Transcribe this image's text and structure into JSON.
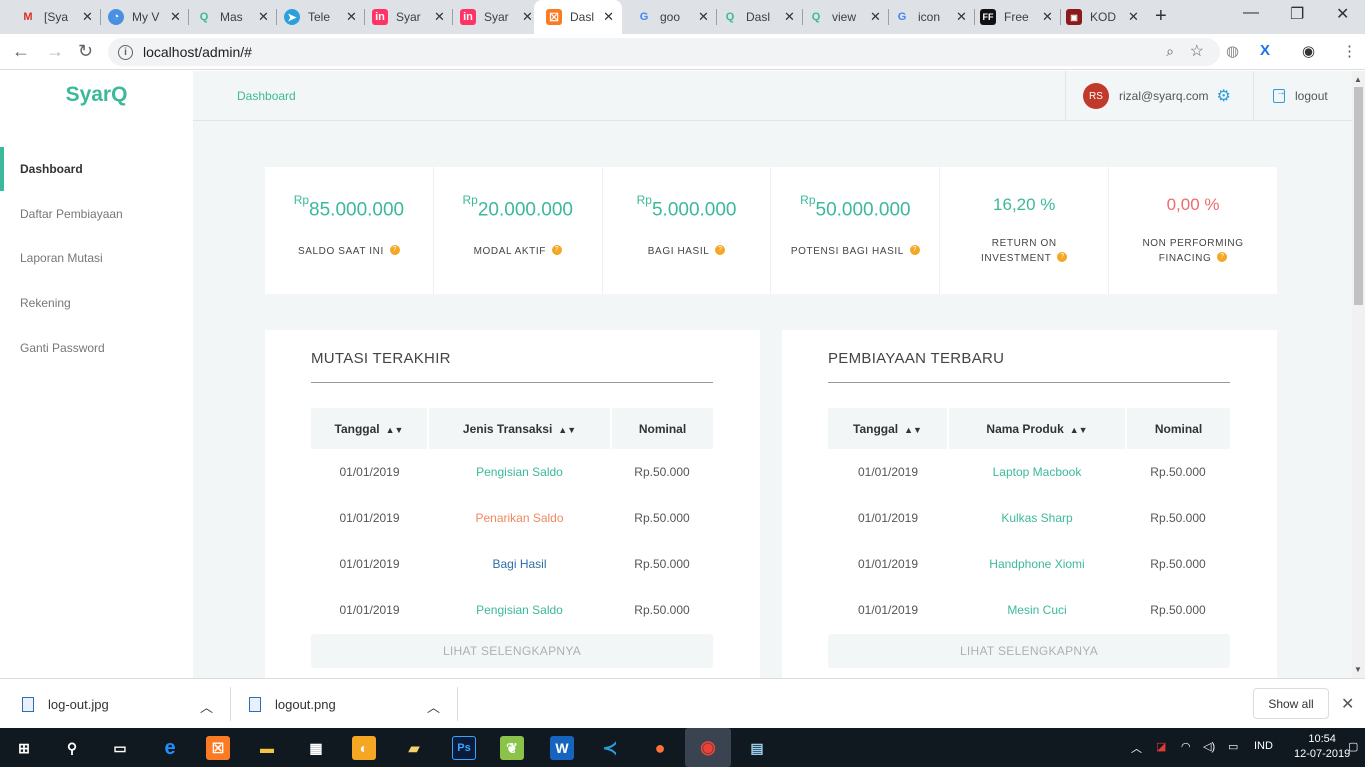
{
  "browser": {
    "tabs": [
      {
        "title": "[Sya",
        "icon": "gmail-icon"
      },
      {
        "title": "My V",
        "icon": "timer-icon"
      },
      {
        "title": "Mas",
        "icon": "q-icon"
      },
      {
        "title": "Tele",
        "icon": "telegram-icon"
      },
      {
        "title": "Syar",
        "icon": "invision-icon"
      },
      {
        "title": "Syar",
        "icon": "invision-icon"
      },
      {
        "title": "Dasl",
        "icon": "xampp-icon"
      },
      {
        "title": "goo",
        "icon": "google-icon"
      },
      {
        "title": "Dasl",
        "icon": "q-icon"
      },
      {
        "title": "view",
        "icon": "q-icon"
      },
      {
        "title": "icon",
        "icon": "google-icon"
      },
      {
        "title": "Free",
        "icon": "ff-icon"
      },
      {
        "title": "KOD",
        "icon": "kode-icon"
      }
    ],
    "url": "localhost/admin/#"
  },
  "app": {
    "logo": "SyarQ",
    "menu": [
      {
        "label": "Dashboard"
      },
      {
        "label": "Daftar Pembiayaan"
      },
      {
        "label": "Laporan Mutasi"
      },
      {
        "label": "Rekening"
      },
      {
        "label": "Ganti Password"
      }
    ],
    "breadcrumb": "Dashboard",
    "user": {
      "initials": "RS",
      "email": "rizal@syarq.com"
    },
    "logout_label": "logout",
    "stats": [
      {
        "prefix": "Rp",
        "value": "85.000.000",
        "label": "SALDO SAAT INI"
      },
      {
        "prefix": "Rp",
        "value": "20.000.000",
        "label": "MODAL AKTIF"
      },
      {
        "prefix": "Rp",
        "value": "5.000.000",
        "label": "BAGI HASIL"
      },
      {
        "prefix": "Rp",
        "value": "50.000.000",
        "label": "POTENSI BAGI HASIL"
      },
      {
        "value": "16,20 %",
        "label1": "RETURN ON",
        "label2": "INVESTMENT"
      },
      {
        "value": "0,00 %",
        "label1": "NON PERFORMING",
        "label2": "FINACING"
      }
    ],
    "mutasi": {
      "title": "MUTASI TERAKHIR",
      "headers": [
        "Tanggal",
        "Jenis Transaksi",
        "Nominal"
      ],
      "rows": [
        {
          "tanggal": "01/01/2019",
          "jenis": "Pengisian Saldo",
          "nominal": "Rp.50.000"
        },
        {
          "tanggal": "01/01/2019",
          "jenis": "Penarikan Saldo",
          "nominal": "Rp.50.000"
        },
        {
          "tanggal": "01/01/2019",
          "jenis": "Bagi Hasil",
          "nominal": "Rp.50.000"
        },
        {
          "tanggal": "01/01/2019",
          "jenis": "Pengisian Saldo",
          "nominal": "Rp.50.000"
        }
      ],
      "more": "LIHAT SELENGKAPNYA"
    },
    "pembiayaan": {
      "title": "PEMBIAYAAN TERBARU",
      "headers": [
        "Tanggal",
        "Nama Produk",
        "Nominal"
      ],
      "rows": [
        {
          "tanggal": "01/01/2019",
          "produk": "Laptop Macbook",
          "nominal": "Rp.50.000"
        },
        {
          "tanggal": "01/01/2019",
          "produk": "Kulkas Sharp",
          "nominal": "Rp.50.000"
        },
        {
          "tanggal": "01/01/2019",
          "produk": "Handphone Xiomi",
          "nominal": "Rp.50.000"
        },
        {
          "tanggal": "01/01/2019",
          "produk": "Mesin Cuci",
          "nominal": "Rp.50.000"
        }
      ],
      "more": "LIHAT SELENGKAPNYA"
    }
  },
  "downloads": {
    "items": [
      {
        "name": "log-out.jpg"
      },
      {
        "name": "logout.png"
      }
    ],
    "show_all": "Show all"
  },
  "taskbar": {
    "lang": "IND",
    "time": "10:54",
    "date": "12-07-2019"
  },
  "colors": {
    "accent": "#3cb99a",
    "negative": "#f06b6b",
    "withdraw": "#f0885f",
    "profit": "#2e6ea8"
  }
}
